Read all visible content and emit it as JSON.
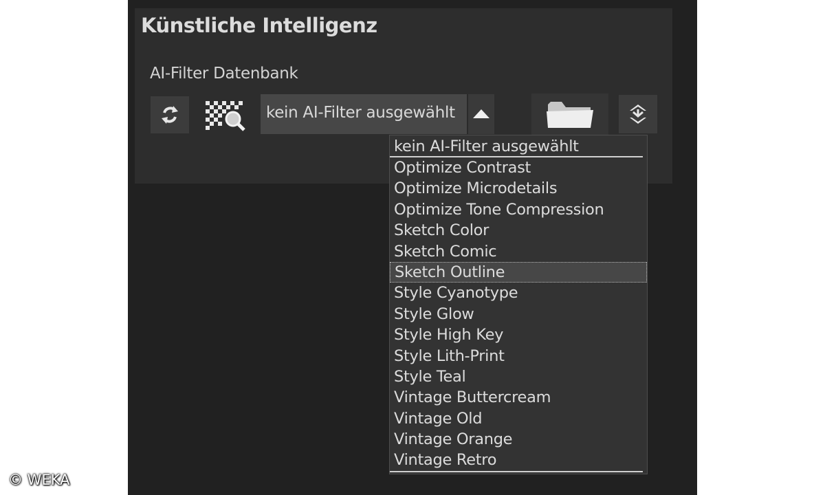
{
  "panel": {
    "title": "Künstliche Intelligenz",
    "group_label": "AI-Filter Datenbank"
  },
  "toolbar": {
    "refresh_icon": "refresh-icon",
    "filter_preview_icon": "filter-preview-icon",
    "folder_icon": "folder-icon",
    "export_icon": "export-icon"
  },
  "select": {
    "value": "kein AI-Filter ausgewählt",
    "expanded": true
  },
  "dropdown": {
    "options": [
      "kein AI-Filter ausgewählt",
      "Optimize Contrast",
      "Optimize Microdetails",
      "Optimize Tone Compression",
      "Sketch Color",
      "Sketch Comic",
      "Sketch Outline",
      "Style Cyanotype",
      "Style Glow",
      "Style High Key",
      "Style Lith-Print",
      "Style Teal",
      "Vintage Buttercream",
      "Vintage Old",
      "Vintage Orange",
      "Vintage Retro"
    ],
    "highlighted": "Sketch Outline"
  },
  "watermark": "© WEKA",
  "colors": {
    "panel_bg": "#212121",
    "section_bg": "#2d2d2d",
    "text": "#dcdcdc"
  }
}
